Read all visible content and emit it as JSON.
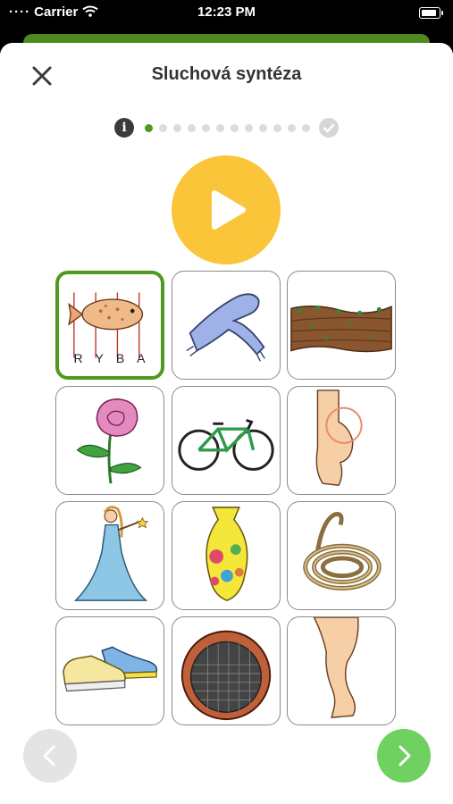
{
  "status_bar": {
    "carrier": "Carrier",
    "time": "12:23 PM"
  },
  "header": {
    "title": "Sluchová syntéza",
    "close_icon": "close-icon"
  },
  "progress": {
    "info_icon": "info-icon",
    "total_steps": 12,
    "current_step": 1,
    "done_icon": "checkmark-icon"
  },
  "play_button": {
    "icon": "play-icon",
    "color": "#fbc53a"
  },
  "cards": [
    {
      "id": "ryba",
      "image": "fish-with-letters",
      "letters": [
        "R",
        "Y",
        "B",
        "A"
      ],
      "selected": true
    },
    {
      "id": "sala",
      "image": "scarf",
      "selected": false
    },
    {
      "id": "pole",
      "image": "plowed-field",
      "selected": false
    },
    {
      "id": "ruze",
      "image": "rose",
      "selected": false
    },
    {
      "id": "kolo",
      "image": "bicycle",
      "selected": false
    },
    {
      "id": "pata",
      "image": "heel-foot",
      "selected": false
    },
    {
      "id": "vila",
      "image": "fairy-princess",
      "selected": false
    },
    {
      "id": "vaza",
      "image": "vase",
      "selected": false
    },
    {
      "id": "lano",
      "image": "rope",
      "selected": false
    },
    {
      "id": "bota",
      "image": "sneakers",
      "selected": false
    },
    {
      "id": "sito",
      "image": "sieve",
      "selected": false
    },
    {
      "id": "noha",
      "image": "leg",
      "selected": false
    }
  ],
  "navigation": {
    "prev_icon": "chevron-left-icon",
    "next_icon": "chevron-right-icon",
    "prev_color": "#e4e4e4",
    "next_color": "#6fd160"
  },
  "colors": {
    "accent": "#4e9a1e",
    "header_strip": "#4e8a1e"
  }
}
